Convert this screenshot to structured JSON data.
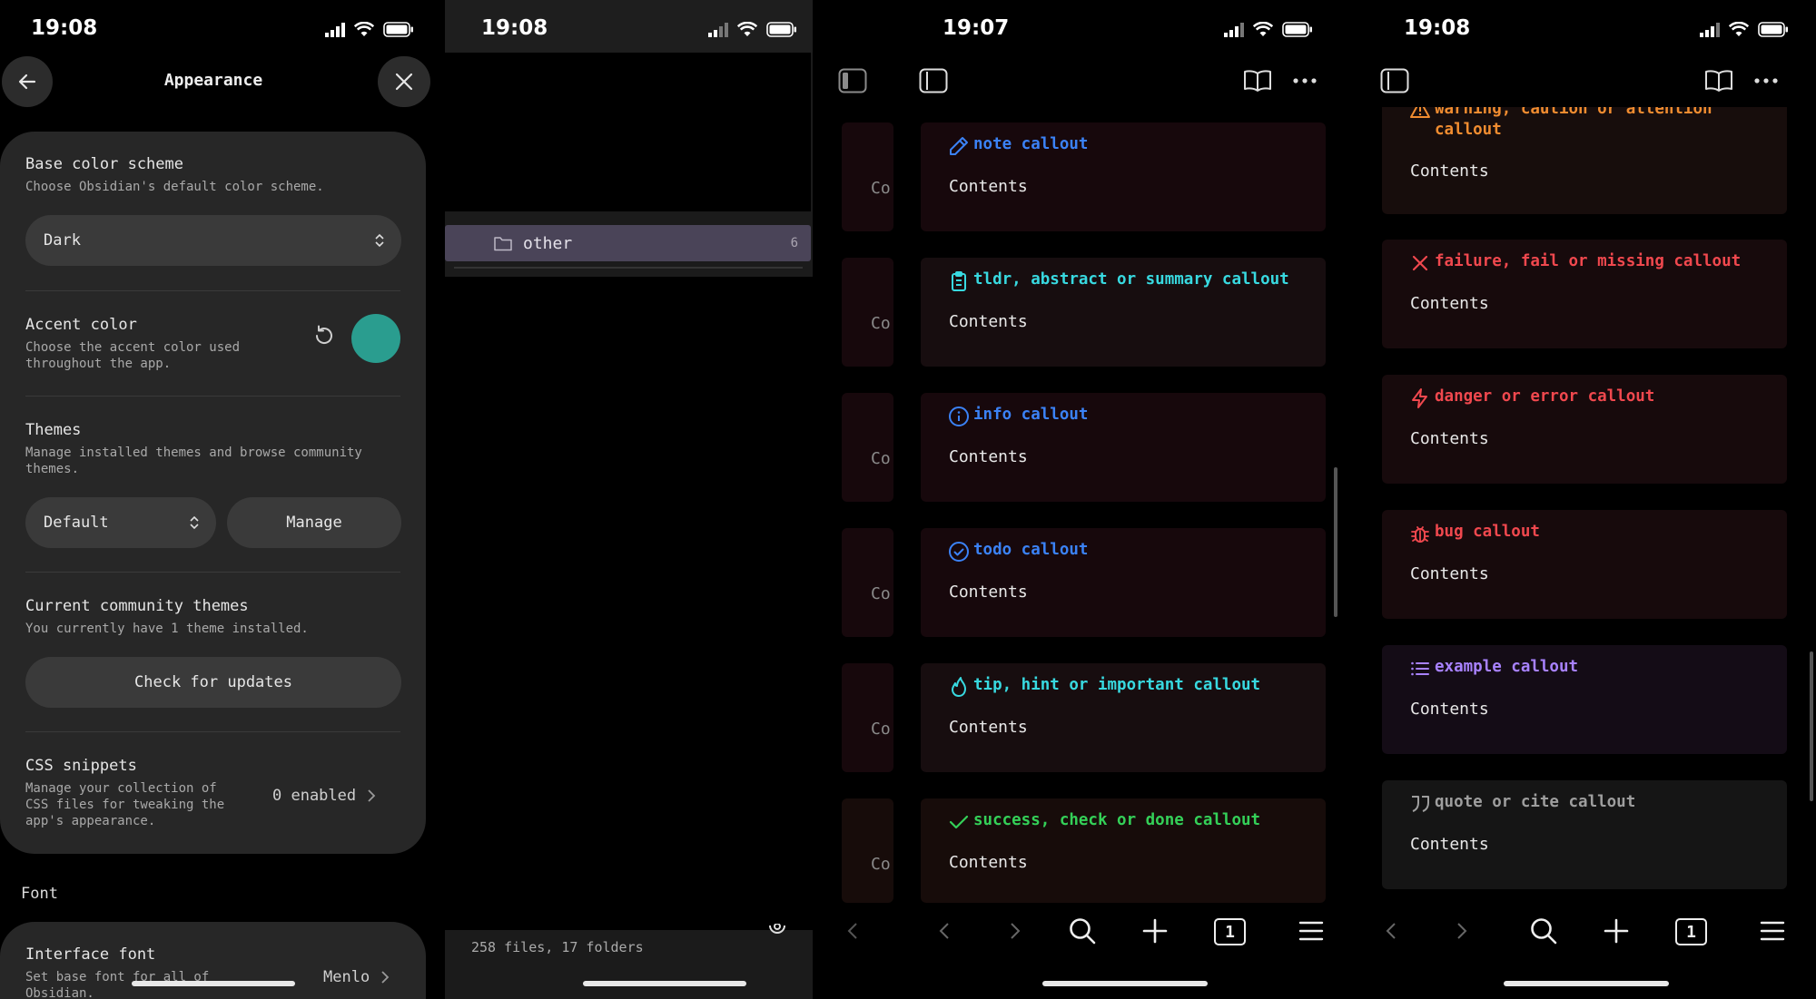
{
  "phone1": {
    "status_time": "19:08",
    "header_title": "Appearance",
    "base_color_scheme": {
      "name": "Base color scheme",
      "desc": "Choose Obsidian's default color scheme.",
      "value": "Dark"
    },
    "accent_color": {
      "name": "Accent color",
      "desc_line1": "Choose the accent color used",
      "desc_line2": "throughout the app.",
      "swatch": "#2a9d8f"
    },
    "themes": {
      "name": "Themes",
      "desc_line1": "Manage installed themes and browse community",
      "desc_line2": "themes.",
      "select_value": "Default",
      "manage_label": "Manage"
    },
    "community_themes": {
      "name": "Current community themes",
      "desc": "You currently have 1 theme installed.",
      "button_label": "Check for updates"
    },
    "css_snippets": {
      "name": "CSS snippets",
      "desc_line1": "Manage your collection of",
      "desc_line2": "CSS files for tweaking the",
      "desc_line3": "app's appearance.",
      "value": "0 enabled"
    },
    "font_section": "Font",
    "interface_font": {
      "name": "Interface font",
      "desc_line1": "Set base font for all of",
      "desc_line2": "Obsidian.",
      "value": "Menlo"
    }
  },
  "phone2": {
    "status_time": "19:08",
    "folder_name": "other",
    "folder_count": "6",
    "footer_stats": "258 files, 17 folders",
    "peek_body": "Co"
  },
  "phone3": {
    "status_time": "19:07",
    "callouts": [
      {
        "title": "note callout",
        "body": "Contents",
        "color": "#3b82f6",
        "icon": "pencil-icon"
      },
      {
        "title": "tldr, abstract or summary callout",
        "body": "Contents",
        "color": "#38d9e0",
        "icon": "clipboard-icon"
      },
      {
        "title": "info callout",
        "body": "Contents",
        "color": "#3b82f6",
        "icon": "info-icon"
      },
      {
        "title": "todo callout",
        "body": "Contents",
        "color": "#3b82f6",
        "icon": "check-circle-icon"
      },
      {
        "title": "tip, hint or important callout",
        "body": "Contents",
        "color": "#38d9e0",
        "icon": "flame-icon"
      },
      {
        "title": "success, check or done callout",
        "body": "Contents",
        "color": "#34d058",
        "icon": "check-icon"
      }
    ]
  },
  "phone4": {
    "status_time": "19:08",
    "callouts": [
      {
        "title_line1": "warning, caution or attention",
        "title_line2": "callout",
        "body": "Contents",
        "color": "#f08c30",
        "icon": "alert-triangle-icon"
      },
      {
        "title": "failure, fail or missing callout",
        "body": "Contents",
        "color": "#f0484e",
        "icon": "x-icon"
      },
      {
        "title": "danger or error callout",
        "body": "Contents",
        "color": "#f0484e",
        "icon": "zap-icon"
      },
      {
        "title": "bug callout",
        "body": "Contents",
        "color": "#f0484e",
        "icon": "bug-icon"
      },
      {
        "title": "example callout",
        "body": "Contents",
        "color": "#a882ff",
        "icon": "list-icon"
      },
      {
        "title": "quote or cite callout",
        "body": "Contents",
        "color": "#9e9e9e",
        "icon": "quote-icon"
      }
    ]
  },
  "tab_count": "1"
}
